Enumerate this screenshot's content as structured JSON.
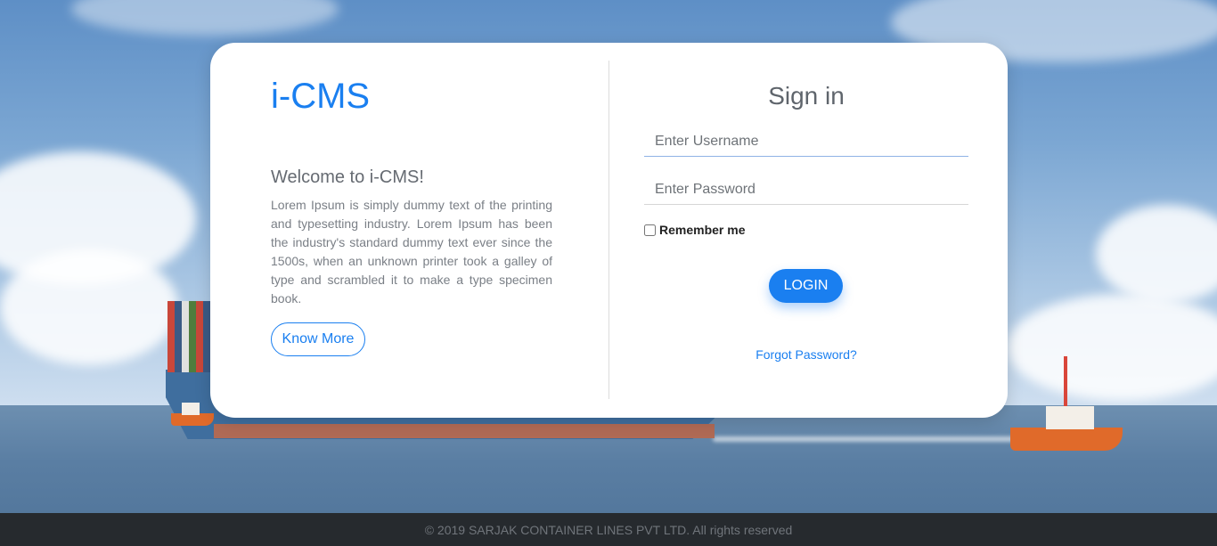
{
  "left": {
    "brand": "i-CMS",
    "welcome": "Welcome to i-CMS!",
    "description": "Lorem Ipsum is simply dummy text of the printing and typesetting industry. Lorem Ipsum has been the industry's standard dummy text ever since the 1500s, when an unknown printer took a galley of type and scrambled it to make a type specimen book.",
    "know_more_label": "Know More"
  },
  "signin": {
    "title": "Sign in",
    "username_placeholder": "Enter Username",
    "password_placeholder": "Enter Password",
    "remember_label": "Remember me",
    "login_label": "LOGIN",
    "forgot_label": "Forgot Password?"
  },
  "footer": {
    "copyright": "© 2019 SARJAK CONTAINER LINES PVT LTD. All rights reserved"
  },
  "colors": {
    "accent": "#1a7ff0",
    "footer_bg": "#262a2e"
  }
}
